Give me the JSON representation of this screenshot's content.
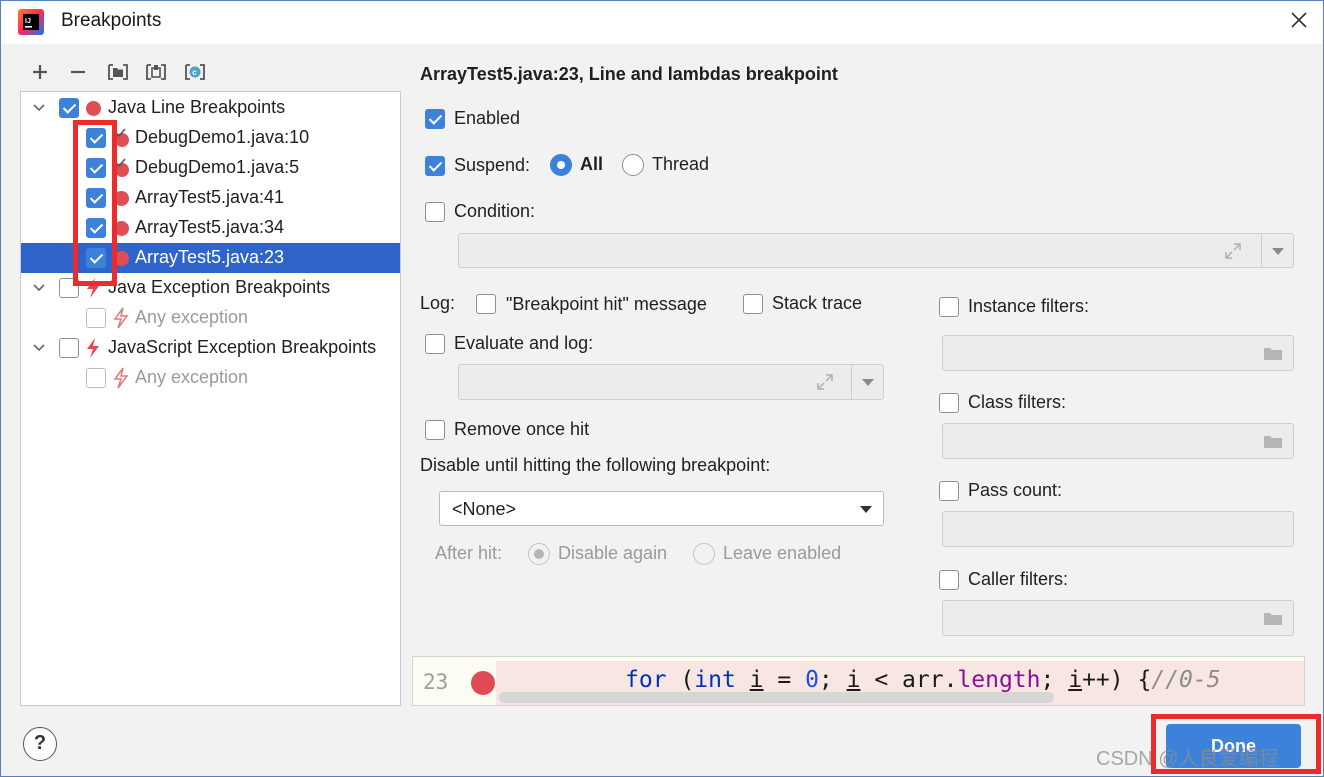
{
  "window": {
    "title": "Breakpoints"
  },
  "toolbar": {
    "icons": [
      "add-icon",
      "remove-icon",
      "group-by-file-icon",
      "group-by-package-icon",
      "group-by-class-icon"
    ]
  },
  "tree": {
    "groups": [
      {
        "label": "Java Line Breakpoints",
        "checked": true,
        "items": [
          {
            "label": "DebugDemo1.java:10",
            "checked": true
          },
          {
            "label": "DebugDemo1.java:5",
            "checked": true
          },
          {
            "label": "ArrayTest5.java:41",
            "checked": true
          },
          {
            "label": "ArrayTest5.java:34",
            "checked": true
          },
          {
            "label": "ArrayTest5.java:23",
            "checked": true,
            "selected": true
          }
        ]
      },
      {
        "label": "Java Exception Breakpoints",
        "checked": false,
        "items": [
          {
            "label": "Any exception",
            "checked": false
          }
        ]
      },
      {
        "label": "JavaScript Exception Breakpoints",
        "checked": false,
        "items": [
          {
            "label": "Any exception",
            "checked": false
          }
        ]
      }
    ]
  },
  "detail": {
    "title": "ArrayTest5.java:23, Line and lambdas breakpoint",
    "enabled_label": "Enabled",
    "suspend_label": "Suspend:",
    "suspend_all": "All",
    "suspend_thread": "Thread",
    "condition_label": "Condition:",
    "log_label": "Log:",
    "log_message": "\"Breakpoint hit\" message",
    "log_stack": "Stack trace",
    "evaluate_label": "Evaluate and log:",
    "remove_once": "Remove once hit",
    "disable_until": "Disable until hitting the following breakpoint:",
    "disable_select": "<None>",
    "after_hit": "After hit:",
    "disable_again": "Disable again",
    "leave_enabled": "Leave enabled",
    "instance_filters": "Instance filters:",
    "class_filters": "Class filters:",
    "pass_count": "Pass count:",
    "caller_filters": "Caller filters:"
  },
  "code": {
    "line_number": "23",
    "tokens": {
      "kw_for": "for",
      "p1": " (",
      "kw_int": "int",
      "sp1": " ",
      "var_i1": "i",
      "p2": " = ",
      "num0": "0",
      "p3": "; ",
      "var_i2": "i",
      "p4": " < arr.",
      "field_length": "length",
      "p5": "; ",
      "var_i3": "i",
      "p6": "++) {",
      "comment": "//0-5"
    }
  },
  "footer": {
    "help": "?",
    "done": "Done",
    "watermark": "CSDN @人良爱编程"
  },
  "colors": {
    "accent": "#3c82da",
    "selection": "#2f65ca",
    "breakpoint": "#de4f55",
    "annotation_box": "#ea2c2c"
  }
}
